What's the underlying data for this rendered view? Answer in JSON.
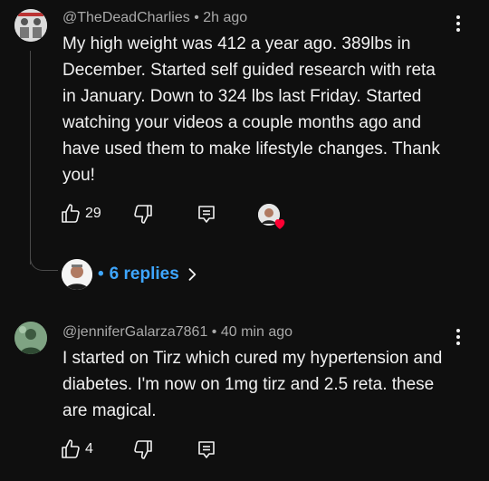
{
  "comments": [
    {
      "handle": "@TheDeadCharlies",
      "time": "2h ago",
      "text_lines": [
        "My high weight was 412 a year ago. 389lbs in",
        "December.  Started self guided research with reta",
        "in January.  Down to 324 lbs last Friday.  Started",
        "watching your videos a couple months ago and",
        "have used them to make lifestyle changes.  Thank",
        "you!"
      ],
      "likes": "29",
      "replies_label": "6 replies",
      "avatar_icon": "profile-avatar"
    },
    {
      "handle": "@jenniferGalarza7861",
      "time": "40 min ago",
      "text_lines": [
        "I started on Tirz which cured my hypertension and",
        "diabetes. I'm now on 1mg tirz and 2.5 reta. these",
        "are magical."
      ],
      "likes": "4",
      "avatar_icon": "profile-avatar"
    }
  ],
  "separator": "•",
  "colors": {
    "background": "#0f0f0f",
    "text": "#f1f1f1",
    "meta": "#aaaaaa",
    "link": "#3ea6ff",
    "heart": "#ff0033"
  },
  "icons": {
    "like": "thumbs-up-icon",
    "dislike": "thumbs-down-icon",
    "reply": "reply-comment-icon",
    "more": "more-vert-icon",
    "heart": "creator-heart-icon",
    "chevron": "chevron-right-icon"
  }
}
